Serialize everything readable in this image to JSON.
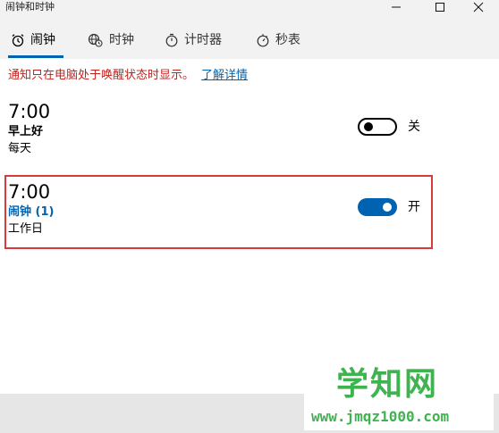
{
  "window": {
    "title": "闹钟和时钟"
  },
  "tabs": [
    {
      "label": "闹钟",
      "icon": "alarm-clock-icon",
      "active": true
    },
    {
      "label": "时钟",
      "icon": "world-clock-icon",
      "active": false
    },
    {
      "label": "计时器",
      "icon": "timer-icon",
      "active": false
    },
    {
      "label": "秒表",
      "icon": "stopwatch-icon",
      "active": false
    }
  ],
  "notice": {
    "text": "通知只在电脑处于唤醒状态时显示。",
    "link": "了解详情"
  },
  "alarms": [
    {
      "time": "7:00",
      "name": "早上好",
      "days": "每天",
      "state_label": "关",
      "on": false
    },
    {
      "time": "7:00",
      "name": "闹钟 (1)",
      "days": "工作日",
      "state_label": "开",
      "on": true
    }
  ],
  "watermark": {
    "title": "学知网",
    "url": "www.jmqz1000.com"
  },
  "colors": {
    "accent": "#0063b1",
    "notice": "#c4211b",
    "highlight": "#d43b3b",
    "watermark": "#3fb34f"
  }
}
